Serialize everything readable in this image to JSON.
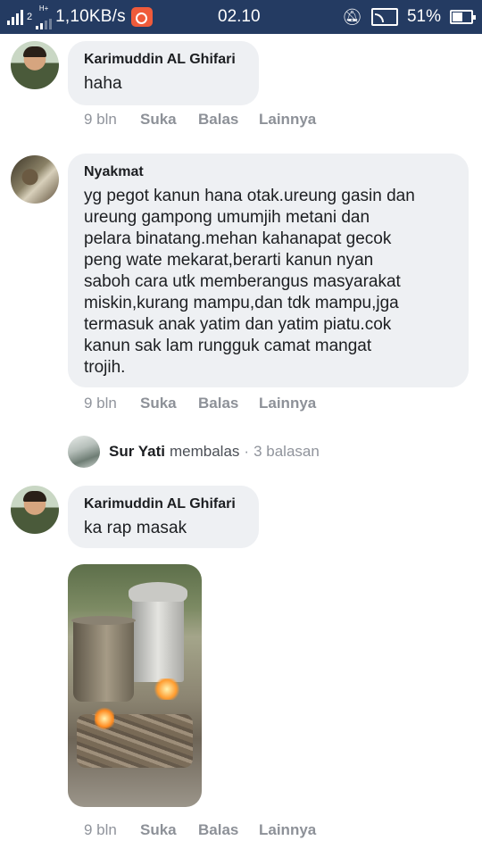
{
  "status_bar": {
    "sim_label": "2",
    "network_type": "H+",
    "speed": "1,10KB/s",
    "time": "02.10",
    "battery": "51%",
    "battery_level": 0.51,
    "icons": [
      "signal-icon",
      "sim-icon",
      "signal-2-icon",
      "screen-record-icon",
      "mute-icon",
      "cast-icon",
      "battery-icon"
    ]
  },
  "comments": [
    {
      "author": "Karimuddin AL Ghifari",
      "text": "haha",
      "time": "9 bln",
      "like": "Suka",
      "reply": "Balas",
      "more": "Lainnya"
    },
    {
      "author": "Nyakmat",
      "text_lines": [
        "yg pegot kanun hana otak.ureung gasin dan",
        "ureung gampong umumjih metani dan",
        "pelara binatang.mehan kahanapat gecok",
        "peng wate mekarat,berarti kanun nyan",
        "saboh cara utk memberangus masyarakat",
        "miskin,kurang mampu,dan tdk mampu,jga",
        "termasuk anak yatim dan yatim piatu.cok",
        "kanun sak lam rungguk camat mangat",
        "trojih."
      ],
      "time": "9 bln",
      "like": "Suka",
      "reply": "Balas",
      "more": "Lainnya",
      "replies": {
        "name": "Sur Yati",
        "verb": "membalas",
        "separator": "·",
        "count": "3 balasan"
      }
    },
    {
      "author": "Karimuddin AL Ghifari",
      "text": "ka rap masak",
      "time": "9 bln",
      "like": "Suka",
      "reply": "Balas",
      "more": "Lainnya"
    }
  ]
}
